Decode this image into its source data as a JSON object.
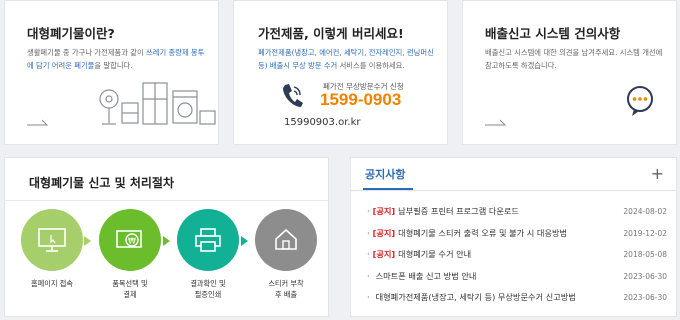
{
  "cards": {
    "what_is": {
      "title": "대형폐기물이란?",
      "desc_plain": "생활폐기물 중 가구나 가전제품과 같이 ",
      "desc_hl": "쓰레기 종량제 봉투에 담기 어려운 폐기물",
      "desc_tail": "을 말합니다."
    },
    "appliance": {
      "title": "가전제품, 이렇게 버리세요!",
      "desc_hl": "폐가전제품(냉장고, 에어컨, 세탁기, 전자레인지, 런닝머신 등) 배출시 무상 방문 수거",
      "desc_tail": " 서비스를 이용하세요.",
      "hotline_label": "폐가전 무상방문수거 신청",
      "hotline_number": "1599-0903",
      "site": "15990903.or.kr"
    },
    "suggestion": {
      "title": "배출신고 시스템 건의사항",
      "desc": "배출신고 시스템에 대한 의견을 남겨주세요. 시스템 개선에 참고하도록 하겠습니다."
    }
  },
  "procedure": {
    "title": "대형폐기물 신고 및 처리절차",
    "steps": [
      {
        "line1": "홈페이지 접속",
        "line2": "",
        "color": "#a6cf6b",
        "icon": "monitor-icon"
      },
      {
        "line1": "품목선택 및",
        "line2": "결제",
        "color": "#6cbd2b",
        "icon": "won-payment-icon"
      },
      {
        "line1": "결과확인 및",
        "line2": "필증인쇄",
        "color": "#12b095",
        "icon": "printer-icon"
      },
      {
        "line1": "스티커 부착",
        "line2": "후 배출",
        "color": "#8d8d8d",
        "icon": "house-hand-icon"
      }
    ]
  },
  "notices": {
    "tab": "공지사항",
    "more": "+",
    "items": [
      {
        "badge": "[공지]",
        "text": "납부필증 프린터 프로그램 다운로드",
        "date": "2024-08-02"
      },
      {
        "badge": "[공지]",
        "text": "대형폐기물 스티커 출력 오류 및 불가 시 대응방법",
        "date": "2019-12-02"
      },
      {
        "badge": "[공지]",
        "text": "대형폐기물 수거 안내",
        "date": "2018-05-08"
      },
      {
        "badge": "",
        "text": "스마트폰 배출 신고 방법 안내",
        "date": "2023-06-30"
      },
      {
        "badge": "",
        "text": "대형폐가전제품(냉장고, 세탁기 등) 무상방문수거 신고방법",
        "date": "2023-06-30"
      }
    ]
  }
}
